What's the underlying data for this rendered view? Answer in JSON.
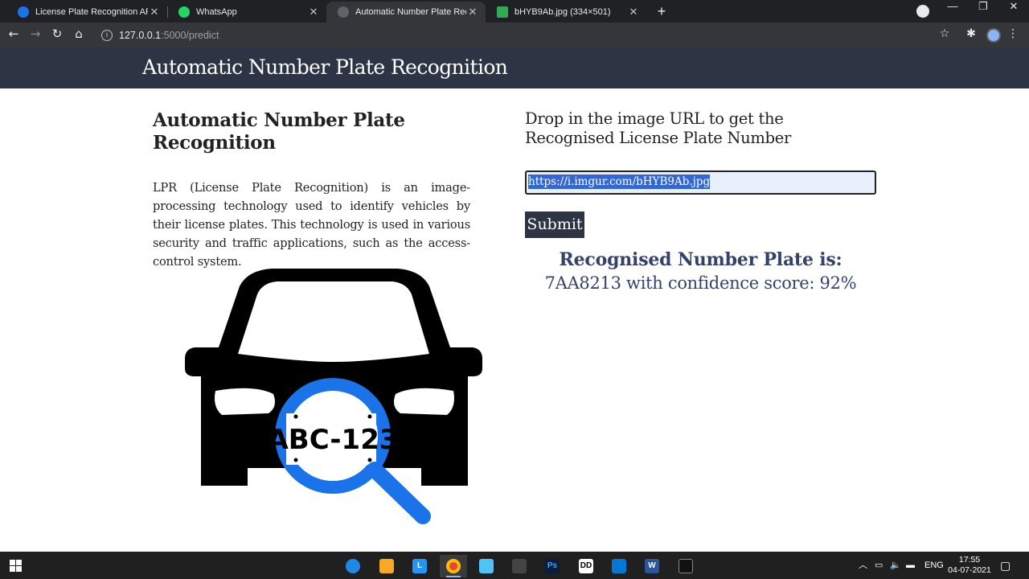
{
  "browser": {
    "tabs": [
      {
        "title": "License Plate Recognition API Do",
        "favicon_color": "#1a73e8",
        "active": false
      },
      {
        "title": "WhatsApp",
        "favicon_color": "#25d366",
        "active": false
      },
      {
        "title": "Automatic Number Plate Recogn",
        "favicon_color": "#5f6368",
        "active": true
      },
      {
        "title": "bHYB9Ab.jpg (334×501)",
        "favicon_color": "#34a853",
        "active": false
      }
    ],
    "url_host": "127.0.0.1",
    "url_path": ":5000/predict"
  },
  "page": {
    "header_title": "Automatic Number Plate Recognition",
    "left": {
      "heading": "Automatic Number Plate Recognition",
      "paragraph": "LPR (License Plate Recognition) is an image-processing technology used to identify vehicles by their license plates. This technology is used in various security and traffic applications, such as the access-control system.",
      "plate_text": "ABC-123"
    },
    "right": {
      "heading": "Drop in the image URL to get the Recognised License Plate Number",
      "input_value": "https://i.imgur.com/bHYB9Ab.jpg",
      "submit_label": "Submit",
      "result_title": "Recognised Number Plate is:",
      "result_value": "7AA8213 with confidence score: 92%"
    }
  },
  "colors": {
    "header_bg": "#2d3444",
    "result_text": "#34426b",
    "magnifier": "#1a73e8"
  },
  "taskbar": {
    "apps": [
      "edge-icon",
      "file-explorer-icon",
      "l-app-icon",
      "chrome-icon",
      "app-icon",
      "store-icon",
      "photoshop-icon",
      "dolby-icon",
      "vscode-icon",
      "word-icon",
      "terminal-icon"
    ],
    "language": "ENG",
    "time": "17:55",
    "date": "04-07-2021"
  }
}
